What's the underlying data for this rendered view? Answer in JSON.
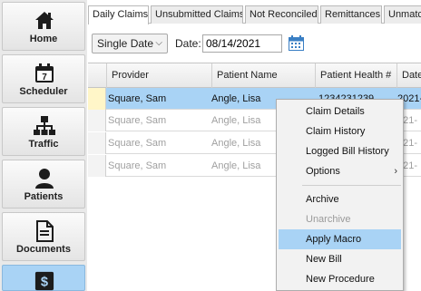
{
  "sidebar": {
    "items": [
      {
        "label": "Home",
        "icon": "home-icon"
      },
      {
        "label": "Scheduler",
        "icon": "calendar-icon"
      },
      {
        "label": "Traffic",
        "icon": "org-chart-icon"
      },
      {
        "label": "Patients",
        "icon": "person-icon"
      },
      {
        "label": "Documents",
        "icon": "document-icon"
      },
      {
        "label": "",
        "icon": "dollar-icon"
      }
    ]
  },
  "tabs": [
    {
      "label": "Daily Claims"
    },
    {
      "label": "Unsubmitted Claims"
    },
    {
      "label": "Not Reconciled"
    },
    {
      "label": "Remittances"
    },
    {
      "label": "Unmatc"
    }
  ],
  "filter": {
    "mode": "Single Date",
    "date_label": "Date:",
    "date_value": "08/14/2021"
  },
  "grid": {
    "columns": [
      "Provider",
      "Patient Name",
      "Patient Health #",
      "Date"
    ],
    "rows": [
      {
        "provider": "Square, Sam",
        "patient": "Angle, Lisa",
        "health": "1234231239",
        "date": "2021-"
      },
      {
        "provider": "Square, Sam",
        "patient": "Angle, Lisa",
        "health": "",
        "date": "021-"
      },
      {
        "provider": "Square, Sam",
        "patient": "Angle, Lisa",
        "health": "",
        "date": "021-"
      },
      {
        "provider": "Square, Sam",
        "patient": "Angle, Lisa",
        "health": "",
        "date": "021-"
      }
    ]
  },
  "context_menu": {
    "items": [
      {
        "label": "Claim Details"
      },
      {
        "label": "Claim History"
      },
      {
        "label": "Logged Bill History"
      },
      {
        "label": "Options",
        "submenu_arrow": "›"
      },
      {
        "label": "Archive"
      },
      {
        "label": "Unarchive"
      },
      {
        "label": "Apply Macro"
      },
      {
        "label": "New Bill"
      },
      {
        "label": "New Procedure"
      }
    ]
  },
  "colors": {
    "accent": "#a9d3f5",
    "sidebar_bg": "#e9e9e9",
    "menu_bg": "#f2f2f2"
  }
}
